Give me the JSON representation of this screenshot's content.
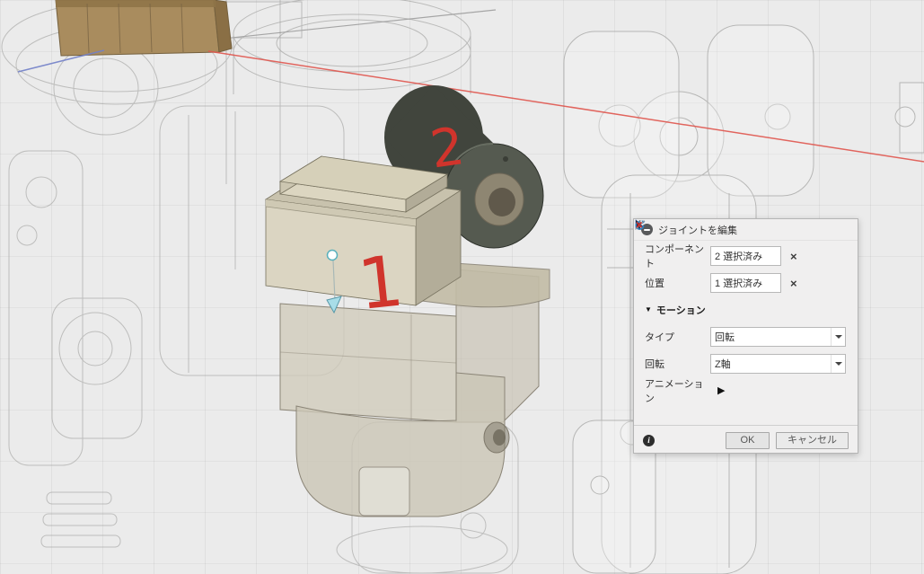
{
  "viewport": {
    "background_color": "#ebebeb",
    "annotations": {
      "mark_one": "1",
      "mark_two": "2"
    },
    "colors": {
      "x_axis_red": "#e0564e",
      "axis_blue": "#7280c8",
      "annotation_red": "#d0342c",
      "selection_teal": "#58b0bc",
      "solid_beige": "#d9d3c0",
      "cylinder_dark": "#41453d",
      "tan_component": "#a98c5e"
    }
  },
  "dialog": {
    "title": "ジョイントを編集",
    "component": {
      "label": "コンポーネント",
      "value": "2 選択済み"
    },
    "position": {
      "label": "位置",
      "value": "1 選択済み"
    },
    "motion": {
      "label": "モーション"
    },
    "type": {
      "label": "タイプ",
      "value": "回転"
    },
    "rotation": {
      "label": "回転",
      "value": "Z軸"
    },
    "animation": {
      "label": "アニメーション"
    },
    "buttons": {
      "ok": "OK",
      "cancel": "キャンセル"
    }
  },
  "icons": {
    "collapse_minus": "−",
    "clear_x": "×",
    "section_open_triangle": "▼",
    "play": "▶",
    "info": "i"
  }
}
